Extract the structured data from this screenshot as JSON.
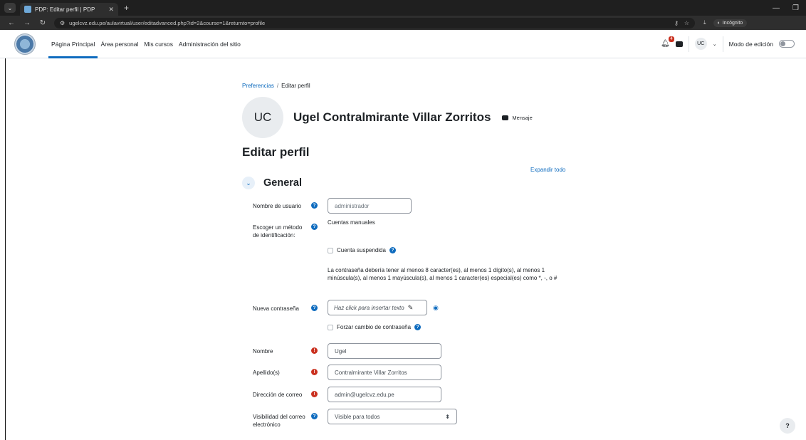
{
  "browser": {
    "tab_title": "PDP: Editar perfil | PDP",
    "url": "ugelcvz.edu.pe/aulavirtual/user/editadvanced.php?id=2&course=1&returnto=profile",
    "incognito_label": "Incógnito"
  },
  "navbar": {
    "links": [
      "Página Principal",
      "Área personal",
      "Mis cursos",
      "Administración del sitio"
    ],
    "notification_count": "4",
    "user_initials": "UC",
    "edit_mode_label": "Modo de edición"
  },
  "breadcrumb": {
    "parent": "Preferencias",
    "separator": "/",
    "current": "Editar perfil"
  },
  "profile": {
    "initials": "UC",
    "full_name": "Ugel Contralmirante Villar Zorritos",
    "message_label": "Mensaje"
  },
  "page_title": "Editar perfil",
  "expand_all": "Expandir todo",
  "section_title": "General",
  "form": {
    "username_label": "Nombre de usuario",
    "username_value": "administrador",
    "auth_label": "Escoger un método de identificación:",
    "auth_value": "Cuentas manuales",
    "suspended_label": "Cuenta suspendida",
    "password_note": "La contraseña debería tener al menos 8 caracter(es), al menos 1 dígito(s), al menos 1 minúscula(s), al menos 1 mayúscula(s), al menos 1 caracter(es) especial(es) como *, -, o #",
    "new_password_label": "Nueva contraseña",
    "new_password_placeholder": "Haz click para insertar texto",
    "force_change_label": "Forzar cambio de contraseña",
    "firstname_label": "Nombre",
    "firstname_value": "Ugel",
    "lastname_label": "Apellido(s)",
    "lastname_value": "Contralmirante Villar Zorritos",
    "email_label": "Dirección de correo",
    "email_value": "admin@ugelcvz.edu.pe",
    "email_visibility_label": "Visibilidad del correo electrónico",
    "email_visibility_value": "Visible para todos"
  },
  "help_button": "?"
}
